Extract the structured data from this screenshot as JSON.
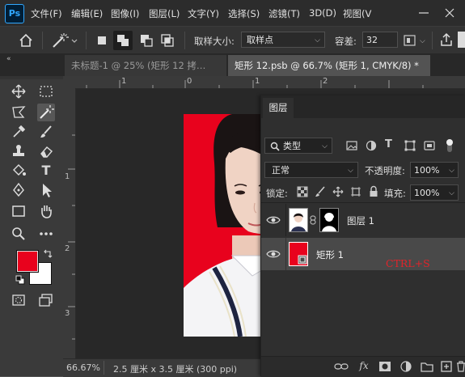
{
  "app": {
    "logo": "Ps"
  },
  "menu": [
    "文件(F)",
    "编辑(E)",
    "图像(I)",
    "图层(L)",
    "文字(Y)",
    "选择(S)",
    "滤镜(T)",
    "3D(D)",
    "视图(V"
  ],
  "options": {
    "sample_size_label": "取样大小:",
    "sample_size_value": "取样点",
    "tolerance_label": "容差:",
    "tolerance_value": "32"
  },
  "tabs": [
    {
      "label": "未标题-1 @ 25% (矩形 12 拷…",
      "active": false
    },
    {
      "label": "矩形 12.psb @ 66.7% (矩形 1, CMYK/8) *",
      "active": true
    }
  ],
  "ruler": {
    "top": [
      "1",
      "0",
      "1",
      "2"
    ],
    "left": [
      "1",
      "2",
      "3"
    ]
  },
  "status": {
    "zoom": "66.67%",
    "doc_size": "2.5 厘米 x 3.5 厘米 (300 ppi)"
  },
  "layers_panel": {
    "title": "图层",
    "filter_type": "类型",
    "blend_mode": "正常",
    "opacity_label": "不透明度:",
    "opacity_value": "100%",
    "lock_label": "锁定:",
    "fill_label": "填充:",
    "fill_value": "100%",
    "layers": [
      {
        "name": "图层 1",
        "visible": true,
        "selected": false
      },
      {
        "name": "矩形 1",
        "visible": true,
        "selected": true
      }
    ],
    "annotation": "CTRL+S"
  },
  "colors": {
    "foreground": "#e8021d",
    "background": "#ffffff",
    "accent": "#31a8ff",
    "annotation": "#e0242a"
  }
}
